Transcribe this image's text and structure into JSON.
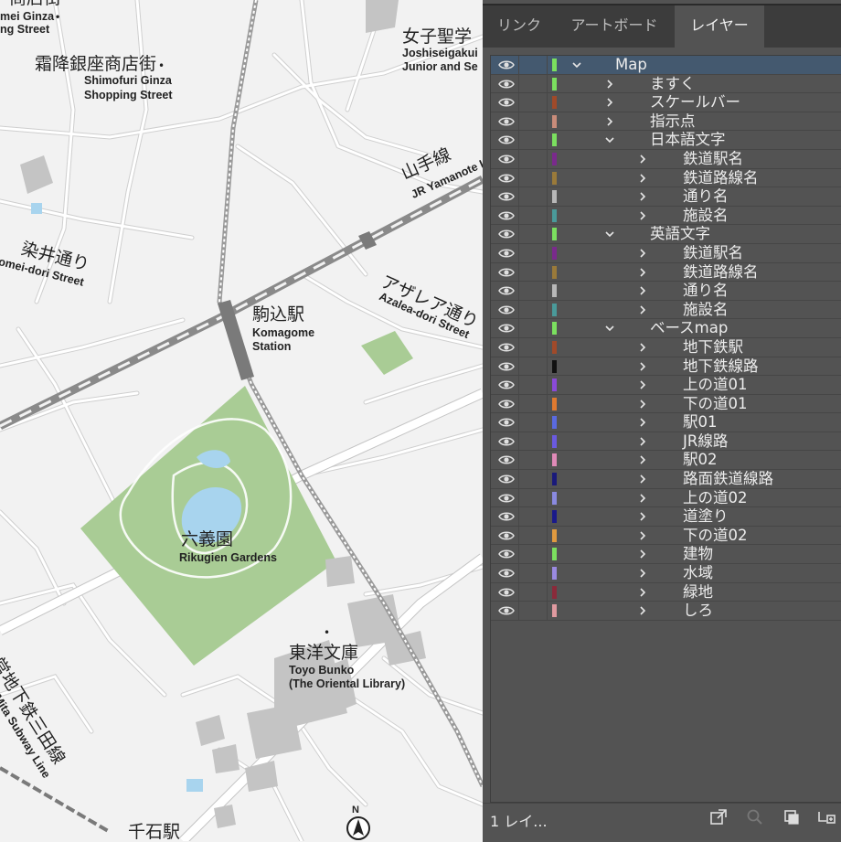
{
  "map": {
    "labels": [
      {
        "id": "ginza-top-ja",
        "text": "商店街"
      },
      {
        "id": "ginza-top-en1",
        "text": "mei Ginza"
      },
      {
        "id": "ginza-top-en2",
        "text": "ng Street"
      },
      {
        "id": "shimofuri-ja",
        "text": "霜降銀座商店街"
      },
      {
        "id": "shimofuri-en1",
        "text": "Shimofuri Ginza"
      },
      {
        "id": "shimofuri-en2",
        "text": "Shopping Street"
      },
      {
        "id": "joshi-ja",
        "text": "女子聖学"
      },
      {
        "id": "joshi-en1",
        "text": "Joshiseigakui"
      },
      {
        "id": "joshi-en2",
        "text": "Junior and Se"
      },
      {
        "id": "yamanote-ja",
        "text": "山手線"
      },
      {
        "id": "yamanote-en",
        "text": "JR Yamanote Li"
      },
      {
        "id": "somei-ja",
        "text": "染井通り"
      },
      {
        "id": "somei-en",
        "text": "omei-dori Street"
      },
      {
        "id": "azalea-ja",
        "text": "アザレア通り"
      },
      {
        "id": "azalea-en",
        "text": "Azalea-dori Street"
      },
      {
        "id": "komagome-ja",
        "text": "駒込駅"
      },
      {
        "id": "komagome-en1",
        "text": "Komagome"
      },
      {
        "id": "komagome-en2",
        "text": "Station"
      },
      {
        "id": "rikugien-ja",
        "text": "六義園"
      },
      {
        "id": "rikugien-en",
        "text": "Rikugien Gardens"
      },
      {
        "id": "toyo-ja",
        "text": "東洋文庫"
      },
      {
        "id": "toyo-en1",
        "text": "Toyo Bunko"
      },
      {
        "id": "toyo-en2",
        "text": "(The Oriental Library)"
      },
      {
        "id": "mita-ja",
        "text": "営地下鉄三田線"
      },
      {
        "id": "mita-en",
        "text": "ei Mita Subway Line"
      },
      {
        "id": "sengoku-ja",
        "text": "千石駅"
      },
      {
        "id": "north-mark",
        "text": "N"
      }
    ]
  },
  "panel": {
    "tabs": [
      {
        "label": "リンク",
        "active": false
      },
      {
        "label": "アートボード",
        "active": false
      },
      {
        "label": "レイヤー",
        "active": true
      }
    ],
    "layers": [
      {
        "name": "Map",
        "level": 0,
        "expanded": true,
        "color": "#7be05f",
        "selected": true
      },
      {
        "name": "ますく",
        "level": 1,
        "expanded": false,
        "color": "#7be05f"
      },
      {
        "name": "スケールバー",
        "level": 1,
        "expanded": false,
        "color": "#a04a2a"
      },
      {
        "name": "指示点",
        "level": 1,
        "expanded": false,
        "color": "#c98c7a"
      },
      {
        "name": "日本語文字",
        "level": 1,
        "expanded": true,
        "color": "#7be05f"
      },
      {
        "name": "鉄道駅名",
        "level": 2,
        "expanded": false,
        "color": "#7a2a8c"
      },
      {
        "name": "鉄道路線名",
        "level": 2,
        "expanded": false,
        "color": "#9a7a3a"
      },
      {
        "name": "通り名",
        "level": 2,
        "expanded": false,
        "color": "#b8b8b8"
      },
      {
        "name": "施設名",
        "level": 2,
        "expanded": false,
        "color": "#4a9a9a"
      },
      {
        "name": "英語文字",
        "level": 1,
        "expanded": true,
        "color": "#7be05f"
      },
      {
        "name": "鉄道駅名",
        "level": 2,
        "expanded": false,
        "color": "#7a2a8c"
      },
      {
        "name": "鉄道路線名",
        "level": 2,
        "expanded": false,
        "color": "#9a7a3a"
      },
      {
        "name": "通り名",
        "level": 2,
        "expanded": false,
        "color": "#b8b8b8"
      },
      {
        "name": "施設名",
        "level": 2,
        "expanded": false,
        "color": "#4a9a9a"
      },
      {
        "name": "ベースmap",
        "level": 1,
        "expanded": true,
        "color": "#7be05f"
      },
      {
        "name": "地下鉄駅",
        "level": 2,
        "expanded": false,
        "color": "#a04a2a"
      },
      {
        "name": "地下鉄線路",
        "level": 2,
        "expanded": false,
        "color": "#111111"
      },
      {
        "name": "上の道01",
        "level": 2,
        "expanded": false,
        "color": "#8a4ad8"
      },
      {
        "name": "下の道01",
        "level": 2,
        "expanded": false,
        "color": "#e07a30"
      },
      {
        "name": "駅01",
        "level": 2,
        "expanded": false,
        "color": "#5a6ae0"
      },
      {
        "name": "JR線路",
        "level": 2,
        "expanded": false,
        "color": "#6a5ae0"
      },
      {
        "name": "駅02",
        "level": 2,
        "expanded": false,
        "color": "#e08ab8"
      },
      {
        "name": "路面鉄道線路",
        "level": 2,
        "expanded": false,
        "color": "#1a1a7a"
      },
      {
        "name": "上の道02",
        "level": 2,
        "expanded": false,
        "color": "#8a8ae0"
      },
      {
        "name": "道塗り",
        "level": 2,
        "expanded": false,
        "color": "#1a1a8a"
      },
      {
        "name": "下の道02",
        "level": 2,
        "expanded": false,
        "color": "#e09a40"
      },
      {
        "name": "建物",
        "level": 2,
        "expanded": false,
        "color": "#7be05f"
      },
      {
        "name": "水域",
        "level": 2,
        "expanded": false,
        "color": "#9a8ae0"
      },
      {
        "name": "緑地",
        "level": 2,
        "expanded": false,
        "color": "#8a2a3a"
      },
      {
        "name": "しろ",
        "level": 2,
        "expanded": false,
        "color": "#e09aa0"
      }
    ],
    "footer": {
      "count": "1 レイ..."
    }
  }
}
